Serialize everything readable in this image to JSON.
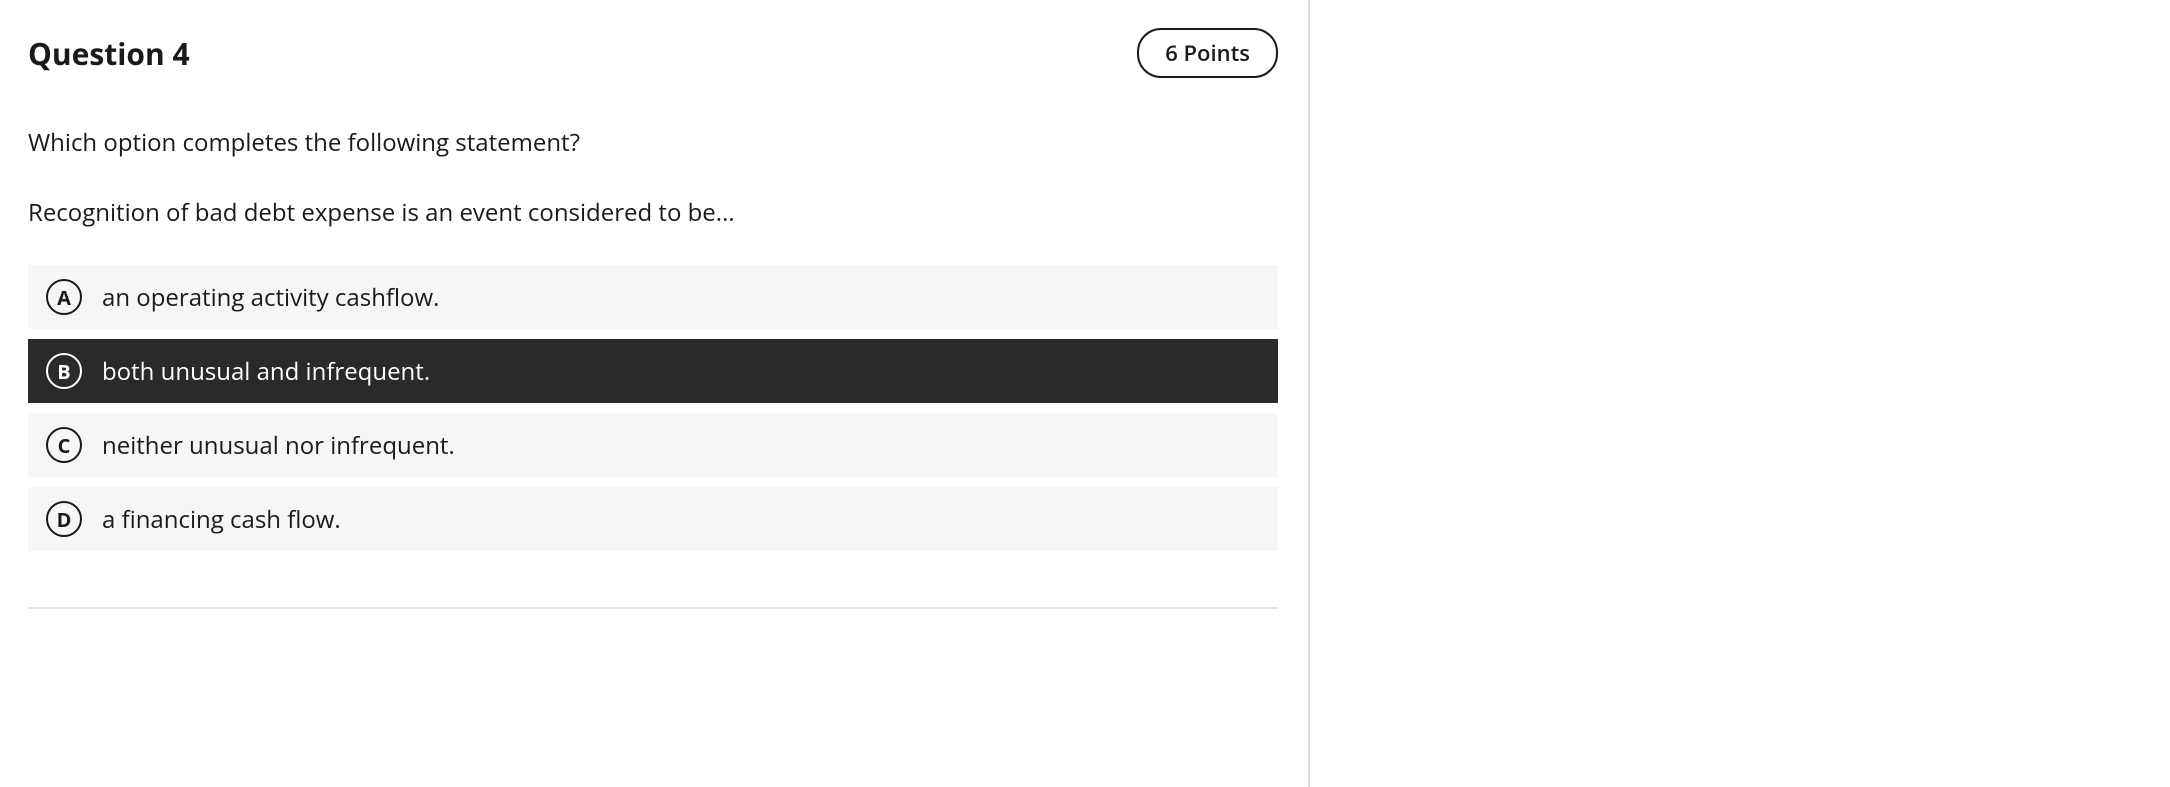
{
  "header": {
    "title": "Question 4",
    "points": "6 Points"
  },
  "prompt": "Which option completes the following statement?",
  "statement": "Recognition of bad debt expense is an event considered to be...",
  "options": [
    {
      "letter": "A",
      "text": "an operating activity cashflow.",
      "selected": false
    },
    {
      "letter": "B",
      "text": "both unusual and infrequent.",
      "selected": true
    },
    {
      "letter": "C",
      "text": "neither unusual nor infrequent.",
      "selected": false
    },
    {
      "letter": "D",
      "text": "a financing cash flow.",
      "selected": false
    }
  ]
}
